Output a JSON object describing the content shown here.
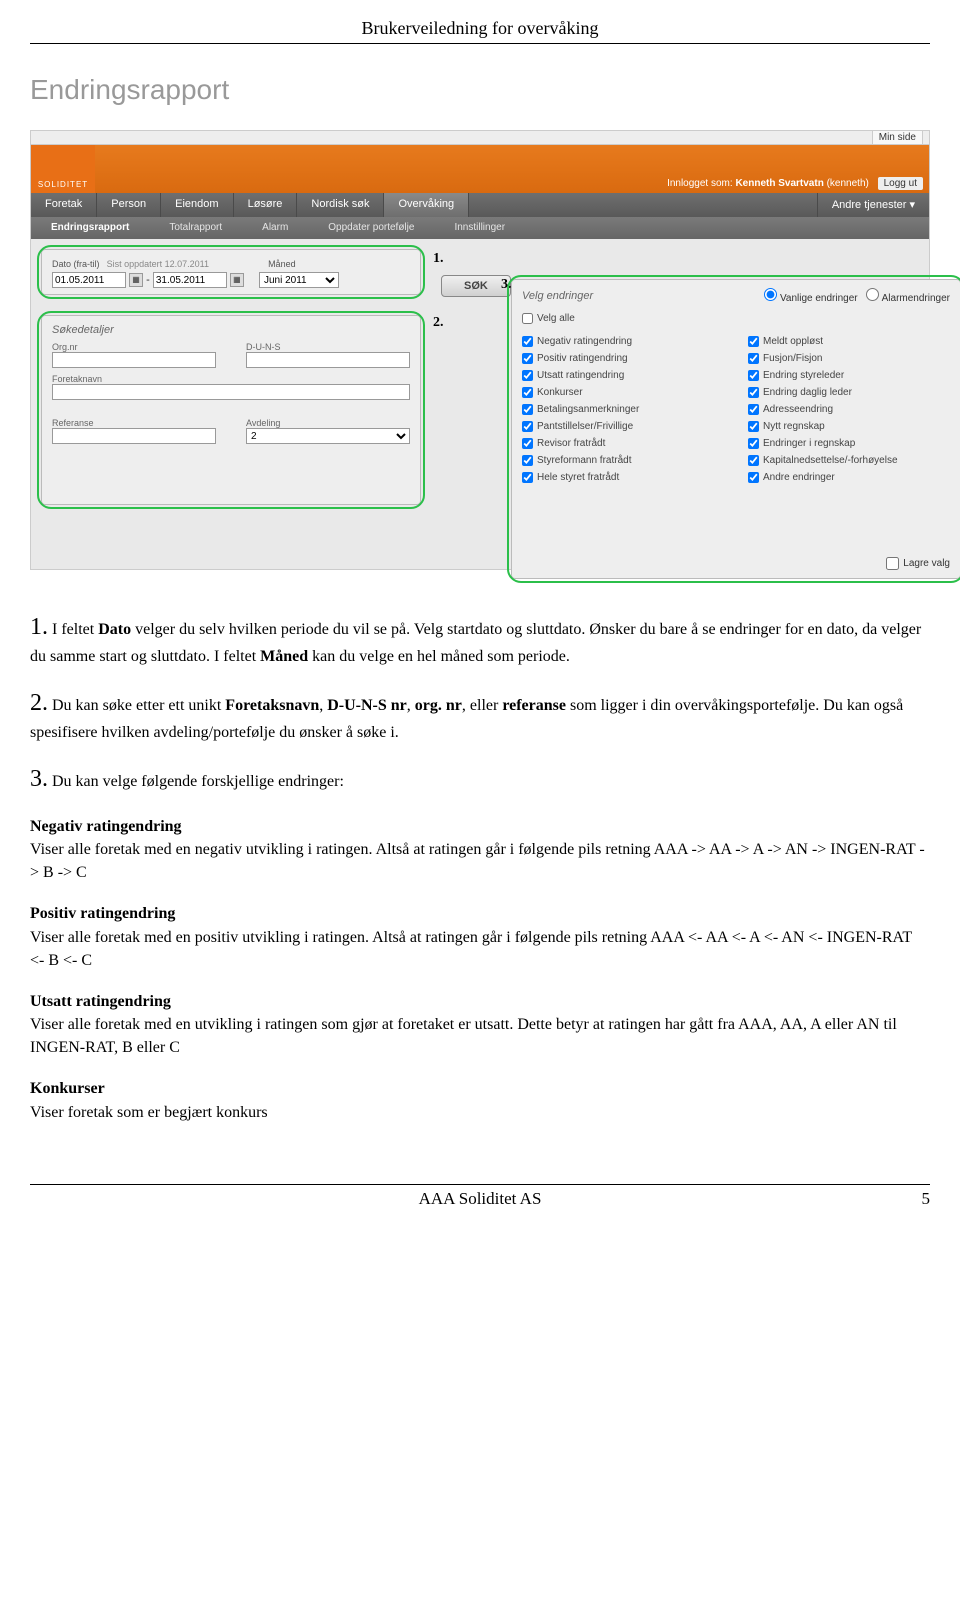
{
  "header": {
    "title": "Brukerveiledning for overvåking"
  },
  "section_title": "Endringsrapport",
  "ss": {
    "minside": "Min side",
    "logo": "SOLIDITET",
    "logged_prefix": "Innlogget som:",
    "user_name": "Kenneth Svartvatn",
    "user_handle": "(kenneth)",
    "logout": "Logg ut",
    "tabs": [
      "Foretak",
      "Person",
      "Eiendom",
      "Løsøre",
      "Nordisk søk",
      "Overvåking"
    ],
    "tab_right": "Andre tjenester ▾",
    "subtabs": [
      "Endringsrapport",
      "Totalrapport",
      "Alarm",
      "Oppdater portefølje",
      "Innstillinger"
    ],
    "date": {
      "label": "Dato (fra-til)",
      "updated": "Sist oppdatert 12.07.2011",
      "from": "01.05.2011",
      "to": "31.05.2011",
      "month_label": "Måned",
      "month_value": "Juni 2011"
    },
    "search_button": "SØK",
    "search_panel": {
      "title": "Søkedetaljer",
      "orgnr": "Org.nr",
      "duns": "D-U-N-S",
      "foretaknavn": "Foretaknavn",
      "referanse": "Referanse",
      "avdeling": "Avdeling",
      "avdeling_value": "2"
    },
    "changes": {
      "title": "Velg endringer",
      "radio1": "Vanlige endringer",
      "radio2": "Alarmendringer",
      "select_all": "Velg alle",
      "col1": [
        "Negativ ratingendring",
        "Positiv ratingendring",
        "Utsatt ratingendring",
        "Konkurser",
        "Betalingsanmerkninger",
        "Pantstillelser/Frivillige",
        "Revisor fratrådt",
        "Styreformann fratrådt",
        "Hele styret fratrådt"
      ],
      "col2": [
        "Meldt oppløst",
        "Fusjon/Fisjon",
        "Endring styreleder",
        "Endring daglig leder",
        "Adresseendring",
        "Nytt regnskap",
        "Endringer i regnskap",
        "Kapitalnedsettelse/-forhøyelse",
        "Andre endringer"
      ],
      "save": "Lagre valg"
    },
    "nums": {
      "n1": "1.",
      "n2": "2.",
      "n3": "3."
    }
  },
  "body": {
    "p1_lead": "1.",
    "p1_a": " I feltet ",
    "p1_b": "Dato",
    "p1_c": " velger du selv hvilken periode du vil se på. Velg startdato og sluttdato. Ønsker du bare å se endringer for en dato, da velger du samme start og sluttdato. I feltet ",
    "p1_d": "Måned",
    "p1_e": " kan du velge en hel måned som periode.",
    "p2_lead": "2.",
    "p2_a": " Du kan søke etter ett unikt ",
    "p2_b": "Foretaksnavn",
    "p2_c": ", ",
    "p2_d": "D-U-N-S nr",
    "p2_e": ", ",
    "p2_f": "org. nr",
    "p2_g": ", eller ",
    "p2_h": "referanse",
    "p2_i": " som ligger i din overvåkingsportefølje. Du kan også spesifisere hvilken avdeling/portefølje du ønsker å søke i.",
    "p3_lead": "3.",
    "p3": " Du kan velge følgende forskjellige endringer:",
    "h_neg": "Negativ ratingendring",
    "p_neg": "Viser alle foretak med en negativ utvikling i ratingen. Altså at ratingen går i følgende pils retning AAA -> AA -> A -> AN -> INGEN-RAT -> B -> C",
    "h_pos": "Positiv ratingendring",
    "p_pos": "Viser alle foretak med en positiv utvikling i ratingen. Altså at ratingen går i følgende pils retning AAA <- AA <- A <- AN <- INGEN-RAT <- B <- C",
    "h_uts": "Utsatt ratingendring",
    "p_uts": "Viser alle foretak med en utvikling i ratingen som gjør at foretaket er utsatt. Dette betyr at ratingen har gått fra AAA, AA, A eller AN til INGEN-RAT, B eller C",
    "h_kon": "Konkurser",
    "p_kon": "Viser foretak som er begjært konkurs"
  },
  "footer": {
    "company": "AAA Soliditet AS",
    "page": "5"
  }
}
